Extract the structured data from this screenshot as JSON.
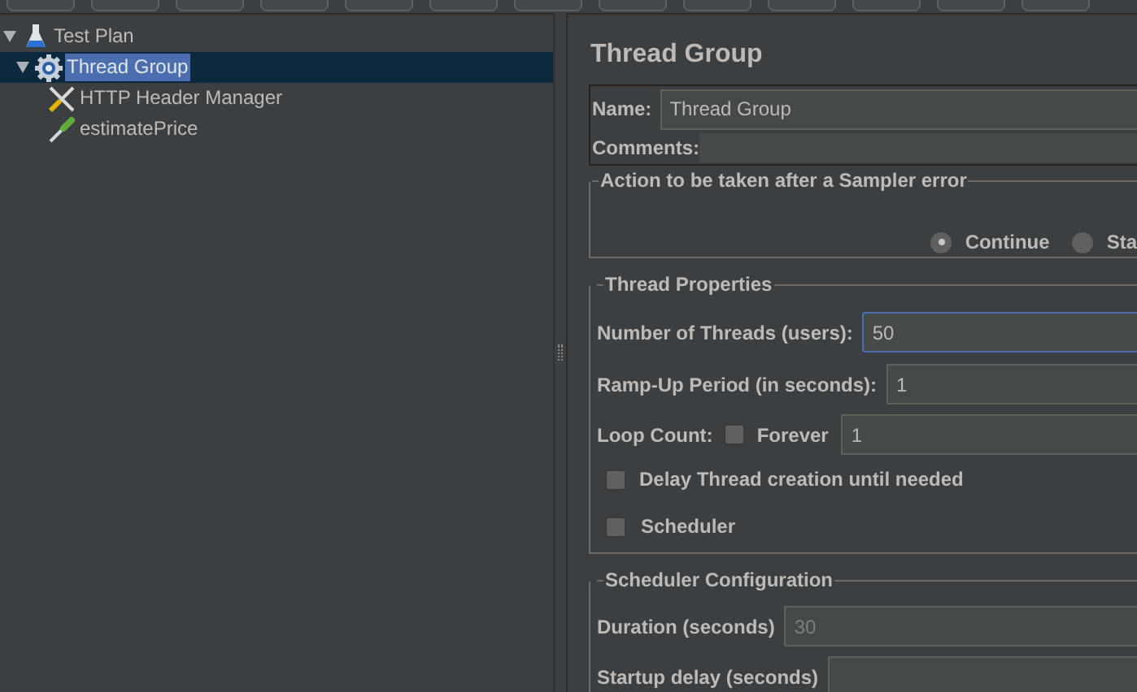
{
  "tree": [
    {
      "label": "Test Plan",
      "kind": "plan",
      "expanded": true,
      "selected": false,
      "children": [
        {
          "label": "Thread Group",
          "kind": "threads",
          "expanded": true,
          "selected": true,
          "children": [
            {
              "label": "HTTP Header Manager",
              "kind": "config",
              "selected": false
            },
            {
              "label": "estimatePrice",
              "kind": "sampler",
              "selected": false
            }
          ]
        }
      ]
    }
  ],
  "panel": {
    "title": "Thread Group",
    "name": {
      "label": "Name:",
      "value": "Thread Group"
    },
    "comments": {
      "label": "Comments:"
    },
    "sampler_error": {
      "title": "Action to be taken after a Sampler error",
      "options": [
        {
          "label": "Continue",
          "selected": true
        },
        {
          "label": "Sta",
          "selected": false
        }
      ]
    },
    "thread_properties": {
      "title": "Thread Properties",
      "threads": {
        "label": "Number of Threads (users):",
        "value": "50",
        "focused": true
      },
      "ramp_up": {
        "label": "Ramp-Up Period (in seconds):",
        "value": "1"
      },
      "loop": {
        "label": "Loop Count:",
        "forever": {
          "label": "Forever",
          "checked": false
        },
        "value": "1"
      },
      "delay": {
        "label": "Delay Thread creation until needed",
        "checked": false
      },
      "scheduler": {
        "label": "Scheduler",
        "checked": false
      }
    },
    "scheduler_config": {
      "title": "Scheduler Configuration",
      "duration": {
        "label": "Duration (seconds)",
        "value": "30",
        "disabled": true
      },
      "startup": {
        "label": "Startup delay (seconds)"
      }
    }
  }
}
